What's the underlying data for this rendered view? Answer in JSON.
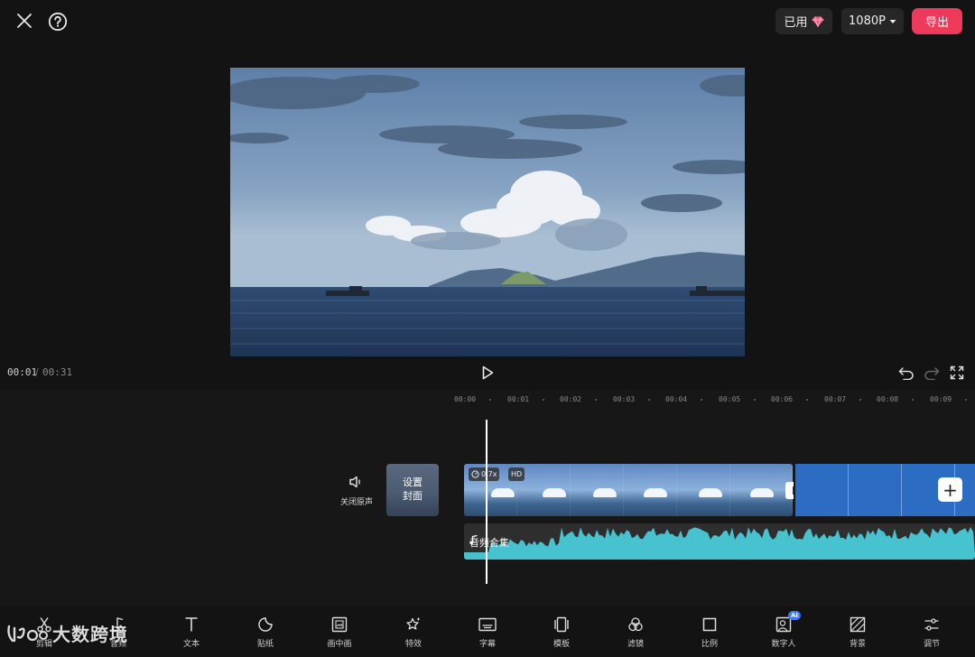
{
  "header": {
    "used_label": "已用",
    "resolution": "1080P",
    "export_label": "导出"
  },
  "player": {
    "current_time": "00:01",
    "separator": "/",
    "total_time": "00:31"
  },
  "ruler": {
    "ticks": [
      "00:00",
      "00:01",
      "00:02",
      "00:03",
      "00:04",
      "00:05",
      "00:06",
      "00:07",
      "00:08",
      "00:09"
    ]
  },
  "timeline": {
    "mute_label": "关闭原声",
    "cover_line1": "设置",
    "cover_line2": "封面",
    "speed_badge": "0.7x",
    "hd_badge": "HD",
    "audio_label": "音频合集",
    "add_symbol": "+"
  },
  "toolbar": {
    "items": [
      {
        "label": "剪辑",
        "icon": "scissors-icon"
      },
      {
        "label": "音频",
        "icon": "music-note-icon"
      },
      {
        "label": "文本",
        "icon": "text-icon"
      },
      {
        "label": "贴纸",
        "icon": "sticker-icon"
      },
      {
        "label": "画中画",
        "icon": "picture-in-picture-icon"
      },
      {
        "label": "特效",
        "icon": "effects-star-icon"
      },
      {
        "label": "字幕",
        "icon": "subtitle-icon"
      },
      {
        "label": "模板",
        "icon": "template-icon"
      },
      {
        "label": "滤镜",
        "icon": "filter-icon"
      },
      {
        "label": "比例",
        "icon": "ratio-icon"
      },
      {
        "label": "数字人",
        "icon": "digital-human-icon"
      },
      {
        "label": "背景",
        "icon": "background-icon"
      },
      {
        "label": "调节",
        "icon": "adjust-sliders-icon"
      }
    ],
    "ai_badge": "AI"
  },
  "watermark": {
    "logo_text": "大数跨境"
  },
  "colors": {
    "background": "#131313",
    "export_accent": "#ee3a5a",
    "clip_blue": "#2c6cc2",
    "waveform": "#46c3cf"
  }
}
